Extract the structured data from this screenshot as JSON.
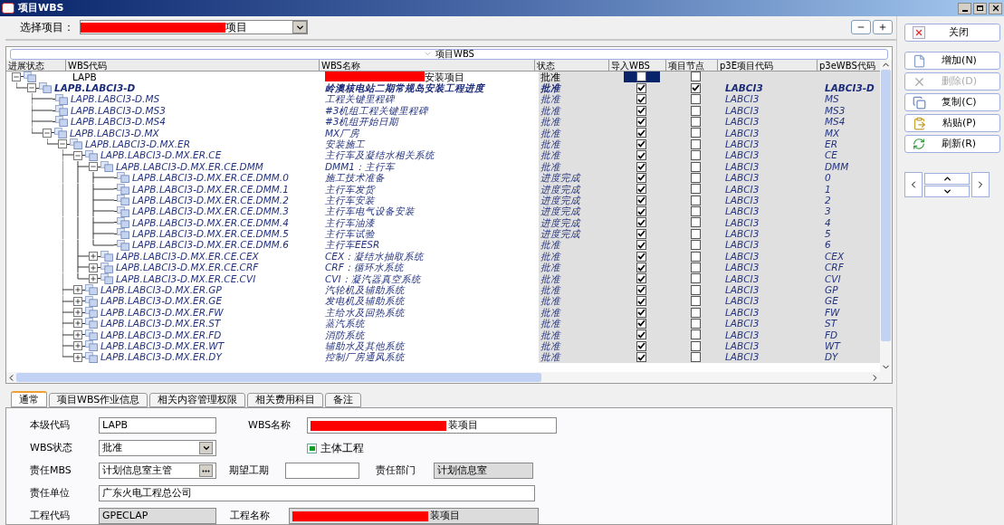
{
  "window": {
    "title": "项目WBS"
  },
  "project_select": {
    "label": "选择项目：",
    "value": "项目",
    "redacted": true
  },
  "table": {
    "group_label": "项目WBS",
    "columns": [
      "进展状态",
      "WBS代码",
      "WBS名称",
      "状态",
      "导入WBS",
      "项目节点",
      "p3E项目代码",
      "p3eWBS代码"
    ],
    "rows": [
      {
        "code": "LAPB",
        "name": "安装项目",
        "name_redacted": true,
        "status": "批准",
        "import_wbs": false,
        "project_node": false,
        "kind": "root",
        "expanded": true,
        "focused": true,
        "children": [
          {
            "code": "LAPB.LABCI3-D",
            "name": "岭澳核电站二期常规岛安装工程进度",
            "status": "批准",
            "import_wbs": true,
            "project_node": true,
            "p3e_code": "LABCI3",
            "p3e_wbs_code": "LABCI3-D",
            "kind": "project",
            "expanded": true,
            "focused": false,
            "children": [
              {
                "code": "LAPB.LABCI3-D.MS",
                "name": "工程关键里程碑",
                "status": "批准",
                "import_wbs": true,
                "project_node": false,
                "p3e_code": "LABCI3",
                "p3e_wbs_code": "MS",
                "kind": "wbs",
                "focused": false
              },
              {
                "code": "LAPB.LABCI3-D.MS3",
                "name": "#3机组工程关键里程碑",
                "status": "批准",
                "import_wbs": true,
                "project_node": false,
                "p3e_code": "LABCI3",
                "p3e_wbs_code": "MS3",
                "kind": "wbs",
                "focused": false
              },
              {
                "code": "LAPB.LABCI3-D.MS4",
                "name": "#3机组开始日期",
                "status": "批准",
                "import_wbs": true,
                "project_node": false,
                "p3e_code": "LABCI3",
                "p3e_wbs_code": "MS4",
                "kind": "wbs",
                "focused": false
              },
              {
                "code": "LAPB.LABCI3-D.MX",
                "name": "MX厂房",
                "status": "批准",
                "import_wbs": true,
                "project_node": false,
                "p3e_code": "LABCI3",
                "p3e_wbs_code": "MX",
                "kind": "wbs",
                "expanded": true,
                "focused": false,
                "children": [
                  {
                    "code": "LAPB.LABCI3-D.MX.ER",
                    "name": "安装施工",
                    "status": "批准",
                    "import_wbs": true,
                    "project_node": false,
                    "p3e_code": "LABCI3",
                    "p3e_wbs_code": "ER",
                    "kind": "wbs",
                    "expanded": true,
                    "focused": false,
                    "children": [
                      {
                        "code": "LAPB.LABCI3-D.MX.ER.CE",
                        "name": "主行车及凝结水相关系统",
                        "status": "批准",
                        "import_wbs": true,
                        "project_node": false,
                        "p3e_code": "LABCI3",
                        "p3e_wbs_code": "CE",
                        "kind": "wbs",
                        "expanded": true,
                        "focused": false,
                        "children": [
                          {
                            "code": "LAPB.LABCI3-D.MX.ER.CE.DMM",
                            "name": "DMM1：主行车",
                            "status": "批准",
                            "import_wbs": true,
                            "project_node": false,
                            "p3e_code": "LABCI3",
                            "p3e_wbs_code": "DMM",
                            "kind": "wbs",
                            "expanded": true,
                            "focused": false,
                            "children": [
                              {
                                "code": "LAPB.LABCI3-D.MX.ER.CE.DMM.0",
                                "name": "施工技术准备",
                                "status": "进度完成",
                                "import_wbs": true,
                                "project_node": false,
                                "p3e_code": "LABCI3",
                                "p3e_wbs_code": "0",
                                "kind": "wbs",
                                "focused": false
                              },
                              {
                                "code": "LAPB.LABCI3-D.MX.ER.CE.DMM.1",
                                "name": "主行车发货",
                                "status": "进度完成",
                                "import_wbs": true,
                                "project_node": false,
                                "p3e_code": "LABCI3",
                                "p3e_wbs_code": "1",
                                "kind": "wbs",
                                "focused": false
                              },
                              {
                                "code": "LAPB.LABCI3-D.MX.ER.CE.DMM.2",
                                "name": "主行车安装",
                                "status": "进度完成",
                                "import_wbs": true,
                                "project_node": false,
                                "p3e_code": "LABCI3",
                                "p3e_wbs_code": "2",
                                "kind": "wbs",
                                "focused": false
                              },
                              {
                                "code": "LAPB.LABCI3-D.MX.ER.CE.DMM.3",
                                "name": "主行车电气设备安装",
                                "status": "进度完成",
                                "import_wbs": true,
                                "project_node": false,
                                "p3e_code": "LABCI3",
                                "p3e_wbs_code": "3",
                                "kind": "wbs",
                                "focused": false
                              },
                              {
                                "code": "LAPB.LABCI3-D.MX.ER.CE.DMM.4",
                                "name": "主行车油漆",
                                "status": "进度完成",
                                "import_wbs": true,
                                "project_node": false,
                                "p3e_code": "LABCI3",
                                "p3e_wbs_code": "4",
                                "kind": "wbs",
                                "focused": false
                              },
                              {
                                "code": "LAPB.LABCI3-D.MX.ER.CE.DMM.5",
                                "name": "主行车试验",
                                "status": "进度完成",
                                "import_wbs": true,
                                "project_node": false,
                                "p3e_code": "LABCI3",
                                "p3e_wbs_code": "5",
                                "kind": "wbs",
                                "focused": false
                              },
                              {
                                "code": "LAPB.LABCI3-D.MX.ER.CE.DMM.6",
                                "name": "主行车EESR",
                                "status": "批准",
                                "import_wbs": true,
                                "project_node": false,
                                "p3e_code": "LABCI3",
                                "p3e_wbs_code": "6",
                                "kind": "wbs",
                                "focused": false
                              }
                            ]
                          },
                          {
                            "code": "LAPB.LABCI3-D.MX.ER.CE.CEX",
                            "name": "CEX：凝结水抽取系统",
                            "status": "批准",
                            "import_wbs": true,
                            "project_node": false,
                            "p3e_code": "LABCI3",
                            "p3e_wbs_code": "CEX",
                            "kind": "wbs",
                            "expanded": false,
                            "focused": false
                          },
                          {
                            "code": "LAPB.LABCI3-D.MX.ER.CE.CRF",
                            "name": "CRF：循环水系统",
                            "status": "批准",
                            "import_wbs": true,
                            "project_node": false,
                            "p3e_code": "LABCI3",
                            "p3e_wbs_code": "CRF",
                            "kind": "wbs",
                            "expanded": false,
                            "focused": false
                          },
                          {
                            "code": "LAPB.LABCI3-D.MX.ER.CE.CVI",
                            "name": "CVI：凝汽器真空系统",
                            "status": "批准",
                            "import_wbs": true,
                            "project_node": false,
                            "p3e_code": "LABCI3",
                            "p3e_wbs_code": "CVI",
                            "kind": "wbs",
                            "expanded": false,
                            "focused": false
                          }
                        ]
                      },
                      {
                        "code": "LAPB.LABCI3-D.MX.ER.GP",
                        "name": "汽轮机及辅助系统",
                        "status": "批准",
                        "import_wbs": true,
                        "project_node": false,
                        "p3e_code": "LABCI3",
                        "p3e_wbs_code": "GP",
                        "kind": "wbs",
                        "expanded": false,
                        "focused": false
                      },
                      {
                        "code": "LAPB.LABCI3-D.MX.ER.GE",
                        "name": "发电机及辅助系统",
                        "status": "批准",
                        "import_wbs": true,
                        "project_node": false,
                        "p3e_code": "LABCI3",
                        "p3e_wbs_code": "GE",
                        "kind": "wbs",
                        "expanded": false,
                        "focused": false
                      },
                      {
                        "code": "LAPB.LABCI3-D.MX.ER.FW",
                        "name": "主给水及回热系统",
                        "status": "批准",
                        "import_wbs": true,
                        "project_node": false,
                        "p3e_code": "LABCI3",
                        "p3e_wbs_code": "FW",
                        "kind": "wbs",
                        "expanded": false,
                        "focused": false
                      },
                      {
                        "code": "LAPB.LABCI3-D.MX.ER.ST",
                        "name": "蒸汽系统",
                        "status": "批准",
                        "import_wbs": true,
                        "project_node": false,
                        "p3e_code": "LABCI3",
                        "p3e_wbs_code": "ST",
                        "kind": "wbs",
                        "expanded": false,
                        "focused": false
                      },
                      {
                        "code": "LAPB.LABCI3-D.MX.ER.FD",
                        "name": "消防系统",
                        "status": "批准",
                        "import_wbs": true,
                        "project_node": false,
                        "p3e_code": "LABCI3",
                        "p3e_wbs_code": "FD",
                        "kind": "wbs",
                        "expanded": false,
                        "focused": false
                      },
                      {
                        "code": "LAPB.LABCI3-D.MX.ER.WT",
                        "name": "辅助水及其他系统",
                        "status": "批准",
                        "import_wbs": true,
                        "project_node": false,
                        "p3e_code": "LABCI3",
                        "p3e_wbs_code": "WT",
                        "kind": "wbs",
                        "expanded": false,
                        "focused": false
                      },
                      {
                        "code": "LAPB.LABCI3-D.MX.ER.DY",
                        "name": "控制厂房通风系统",
                        "status": "批准",
                        "import_wbs": true,
                        "project_node": false,
                        "p3e_code": "LABCI3",
                        "p3e_wbs_code": "DY",
                        "kind": "wbs",
                        "expanded": false,
                        "focused": false
                      }
                    ]
                  }
                ]
              }
            ]
          }
        ]
      }
    ]
  },
  "side_buttons": [
    {
      "label": "关闭",
      "kind": "close",
      "disabled": false
    },
    {
      "label": "增加(N)",
      "kind": "add",
      "disabled": false
    },
    {
      "label": "删除(D)",
      "kind": "delete",
      "disabled": true
    },
    {
      "label": "复制(C)",
      "kind": "copy",
      "disabled": false
    },
    {
      "label": "粘贴(P)",
      "kind": "paste",
      "disabled": false
    },
    {
      "label": "刷新(R)",
      "kind": "refresh",
      "disabled": false
    }
  ],
  "detail_tabs": [
    {
      "label": "通常",
      "selected": true
    },
    {
      "label": "项目WBS作业信息",
      "selected": false
    },
    {
      "label": "相关内容管理权限",
      "selected": false
    },
    {
      "label": "相关费用科目",
      "selected": false
    },
    {
      "label": "备注",
      "selected": false
    }
  ],
  "form": {
    "level_code": {
      "label": "本级代码",
      "value": "LAPB",
      "readonly": false
    },
    "wbs_name": {
      "label": "WBS名称",
      "value": "装项目",
      "redacted": true,
      "readonly": false
    },
    "wbs_status": {
      "label": "WBS状态",
      "value": "批准"
    },
    "main_project": {
      "label": "主体工程",
      "checked": true
    },
    "owner_mbs": {
      "label": "责任MBS",
      "value": "计划信息室主管"
    },
    "expected_duration": {
      "label": "期望工期",
      "readonly": false
    },
    "owner_dept": {
      "label": "责任部门",
      "value": "计划信息室",
      "readonly": true
    },
    "owner_unit": {
      "label": "责任单位",
      "value": "广东火电工程总公司",
      "readonly": false
    },
    "project_code": {
      "label": "工程代码",
      "value": "GPECLAP",
      "readonly": true
    },
    "project_name": {
      "label": "工程名称",
      "value": "装项目",
      "redacted": true,
      "readonly": true
    }
  }
}
